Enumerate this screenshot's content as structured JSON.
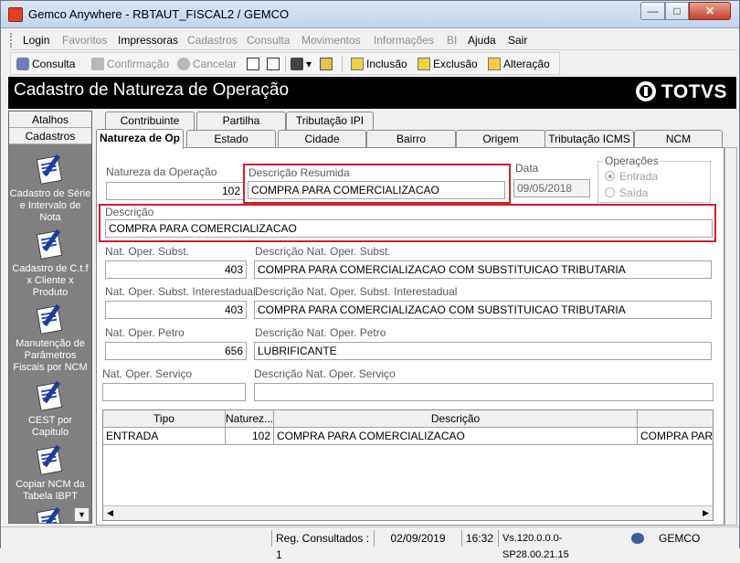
{
  "window": {
    "title": "Gemco Anywhere - RBTAUT_FISCAL2 / GEMCO",
    "minimize": "—",
    "maximize": "□",
    "close": "✕"
  },
  "menu": [
    {
      "label": "Login",
      "enabled": true
    },
    {
      "label": "Favoritos",
      "enabled": false
    },
    {
      "label": "Impressoras",
      "enabled": true
    },
    {
      "label": "Cadastros",
      "enabled": false
    },
    {
      "label": "Consulta",
      "enabled": false
    },
    {
      "label": "Movimentos",
      "enabled": false
    },
    {
      "label": "Informações",
      "enabled": false
    },
    {
      "label": "BI",
      "enabled": false
    },
    {
      "label": "Ajuda",
      "enabled": true
    },
    {
      "label": "Sair",
      "enabled": true
    }
  ],
  "toolbar": {
    "consulta": "Consulta",
    "confirmacao": "Confirmação",
    "cancelar": "Cancelar",
    "inclusao": "Inclusão",
    "exclusao": "Exclusão",
    "alteracao": "Alteração"
  },
  "header": {
    "title": "Cadastro de Natureza de Operação",
    "logo": "TOTVS"
  },
  "sidebar": {
    "tabs": [
      "Atalhos",
      "Cadastros"
    ],
    "items": [
      {
        "label": "Cadastro de Série e Intervalo de Nota",
        "icon": "document-pen-icon"
      },
      {
        "label": "Cadastro de C.t.f x Cliente x Produto",
        "icon": "document-pen-icon"
      },
      {
        "label": "Manutenção de Parâmetros Fiscais por NCM",
        "icon": "document-pen-icon"
      },
      {
        "label": "CEST por Capitulo",
        "icon": "document-pen-icon"
      },
      {
        "label": "Copiar NCM da Tabela IBPT",
        "icon": "document-pen-icon"
      }
    ]
  },
  "tabs": {
    "row1": [
      "Contribuinte",
      "Partilha",
      "Tributação IPI"
    ],
    "row2": [
      "Natureza de Op",
      "Estado",
      "Cidade",
      "Bairro",
      "Origem",
      "Tributação ICMS",
      "NCM"
    ],
    "active": "Natureza de Op"
  },
  "form": {
    "natureza_label": "Natureza da Operação",
    "natureza_value": "102",
    "desc_resumida_label": "Descrição Resumida",
    "desc_resumida_value": "COMPRA PARA COMERCIALIZACAO",
    "data_label": "Data",
    "data_value": "09/05/2018",
    "operacoes_label": "Operações",
    "entrada_label": "Entrada",
    "saida_label": "Saída",
    "operacao_selecionada": "Entrada",
    "descricao_label": "Descrição",
    "descricao_value": "COMPRA PARA COMERCIALIZACAO",
    "subst_label": "Nat. Oper. Subst.",
    "subst_value": "403",
    "subst_desc_label": "Descrição Nat. Oper. Subst.",
    "subst_desc_value": "COMPRA PARA COMERCIALIZACAO COM SUBSTITUICAO TRIBUTARIA",
    "subst_inter_label": "Nat. Oper. Subst. Interestadual",
    "subst_inter_value": "403",
    "subst_inter_desc_label": "Descrição Nat. Oper. Subst. Interestadual",
    "subst_inter_desc_value": "COMPRA PARA COMERCIALIZACAO COM SUBSTITUICAO TRIBUTARIA",
    "petro_label": "Nat. Oper. Petro",
    "petro_value": "656",
    "petro_desc_label": "Descrição Nat. Oper. Petro",
    "petro_desc_value": "LUBRIFICANTE",
    "servico_label": "Nat. Oper. Serviço",
    "servico_value": "",
    "servico_desc_label": "Descrição Nat. Oper. Serviço",
    "servico_desc_value": ""
  },
  "grid": {
    "columns": [
      "Tipo",
      "Naturez...",
      "Descrição",
      ""
    ],
    "rows": [
      [
        "ENTRADA",
        "102",
        "COMPRA PARA COMERCIALIZACAO",
        "COMPRA PARA"
      ]
    ]
  },
  "status": {
    "registros": "Reg. Consultados : 1",
    "date": "02/09/2019",
    "time": "16:32",
    "version": "Vs.120.0.0.0-SP28.00.21.15",
    "company": "GEMCO"
  },
  "colors": {
    "highlight": "#d1202a",
    "header_bg": "#000000",
    "sidebar_bg": "#808080"
  }
}
